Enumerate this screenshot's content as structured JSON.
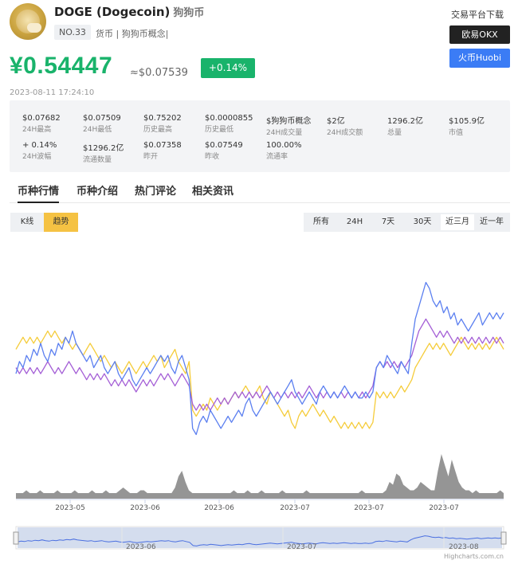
{
  "header": {
    "symbol_title": "DOGE (Dogecoin)",
    "cn_name": "狗狗币",
    "rank": "NO.33",
    "tags": "货币 | 狗狗币概念|"
  },
  "platforms": {
    "title": "交易平台下载",
    "okx": "欧易OKX",
    "huobi": "火币Huobi"
  },
  "price": {
    "cny": "¥0.54447",
    "usd": "≈$0.07539",
    "change": "+0.14%",
    "timestamp": "2023-08-11 17:24:10",
    "color_up": "#19b36b"
  },
  "stats": [
    {
      "value": "$0.07682",
      "label": "24H最高"
    },
    {
      "value": "$0.07509",
      "label": "24H最低"
    },
    {
      "value": "$0.75202",
      "label": "历史最高"
    },
    {
      "value": "$0.0000855",
      "label": "历史最低"
    },
    {
      "value": "$狗狗币概念",
      "label": "24H成交量"
    },
    {
      "value": "$2亿",
      "label": "24H成交额"
    },
    {
      "value": "1296.2亿",
      "label": "总量"
    },
    {
      "value": "$105.9亿",
      "label": "市值"
    },
    {
      "value": "+ 0.14%",
      "label": "24H波幅"
    },
    {
      "value": "$1296.2亿",
      "label": "流通数量"
    },
    {
      "value": "$0.07358",
      "label": "昨开"
    },
    {
      "value": "$0.07549",
      "label": "昨收"
    },
    {
      "value": "100.00%",
      "label": "流通率"
    }
  ],
  "tabs": [
    {
      "label": "币种行情",
      "active": true
    },
    {
      "label": "币种介绍",
      "active": false
    },
    {
      "label": "热门评论",
      "active": false
    },
    {
      "label": "相关资讯",
      "active": false
    }
  ],
  "chart_controls": {
    "kline": "K线",
    "trend": "趋势",
    "ranges": [
      "所有",
      "24H",
      "7天",
      "30天",
      "近三月",
      "近一年"
    ],
    "active_range": "近三月"
  },
  "chart_data": {
    "type": "line",
    "x_tick_labels": [
      "2023-05",
      "2023-06",
      "2023-06",
      "2023-07",
      "2023-07",
      "2023-07"
    ],
    "navigator_labels": [
      "2023-06",
      "2023-07",
      "2023-08"
    ],
    "credit": "Highcharts.com.cn",
    "colors": {
      "blue": "#5b7ff0",
      "yellow": "#f5cc3a",
      "purple": "#a45fd6",
      "volume": "#8a8a8a"
    },
    "series": [
      {
        "color": "blue",
        "values": [
          0.061,
          0.063,
          0.062,
          0.064,
          0.063,
          0.065,
          0.064,
          0.066,
          0.064,
          0.063,
          0.065,
          0.064,
          0.066,
          0.065,
          0.067,
          0.066,
          0.068,
          0.066,
          0.065,
          0.064,
          0.063,
          0.064,
          0.062,
          0.063,
          0.064,
          0.062,
          0.061,
          0.062,
          0.063,
          0.061,
          0.06,
          0.061,
          0.062,
          0.06,
          0.059,
          0.06,
          0.061,
          0.062,
          0.061,
          0.062,
          0.063,
          0.064,
          0.063,
          0.064,
          0.062,
          0.061,
          0.063,
          0.064,
          0.062,
          0.06,
          0.052,
          0.051,
          0.053,
          0.054,
          0.053,
          0.055,
          0.054,
          0.053,
          0.052,
          0.053,
          0.054,
          0.053,
          0.054,
          0.055,
          0.054,
          0.056,
          0.057,
          0.055,
          0.054,
          0.055,
          0.056,
          0.057,
          0.058,
          0.057,
          0.056,
          0.057,
          0.058,
          0.059,
          0.06,
          0.058,
          0.057,
          0.056,
          0.057,
          0.058,
          0.057,
          0.056,
          0.058,
          0.059,
          0.058,
          0.057,
          0.058,
          0.057,
          0.058,
          0.059,
          0.058,
          0.057,
          0.058,
          0.057,
          0.057,
          0.058,
          0.057,
          0.058,
          0.062,
          0.063,
          0.062,
          0.064,
          0.063,
          0.062,
          0.061,
          0.063,
          0.062,
          0.061,
          0.066,
          0.07,
          0.072,
          0.074,
          0.076,
          0.075,
          0.073,
          0.072,
          0.073,
          0.071,
          0.072,
          0.07,
          0.071,
          0.069,
          0.07,
          0.069,
          0.068,
          0.069,
          0.07,
          0.071,
          0.069,
          0.07,
          0.071,
          0.07,
          0.071,
          0.07,
          0.071
        ]
      },
      {
        "color": "yellow",
        "values": [
          0.065,
          0.066,
          0.067,
          0.066,
          0.067,
          0.066,
          0.067,
          0.066,
          0.067,
          0.068,
          0.067,
          0.068,
          0.067,
          0.066,
          0.067,
          0.066,
          0.065,
          0.066,
          0.065,
          0.064,
          0.065,
          0.066,
          0.065,
          0.064,
          0.063,
          0.064,
          0.063,
          0.062,
          0.063,
          0.062,
          0.061,
          0.062,
          0.063,
          0.062,
          0.061,
          0.062,
          0.063,
          0.062,
          0.063,
          0.064,
          0.063,
          0.064,
          0.062,
          0.063,
          0.064,
          0.065,
          0.063,
          0.062,
          0.061,
          0.063,
          0.055,
          0.054,
          0.055,
          0.056,
          0.055,
          0.057,
          0.056,
          0.055,
          0.056,
          0.057,
          0.056,
          0.057,
          0.058,
          0.057,
          0.058,
          0.059,
          0.058,
          0.057,
          0.058,
          0.059,
          0.057,
          0.056,
          0.058,
          0.057,
          0.056,
          0.055,
          0.054,
          0.055,
          0.053,
          0.052,
          0.054,
          0.055,
          0.054,
          0.055,
          0.056,
          0.055,
          0.054,
          0.055,
          0.054,
          0.053,
          0.054,
          0.053,
          0.052,
          0.053,
          0.052,
          0.053,
          0.052,
          0.053,
          0.052,
          0.053,
          0.052,
          0.053,
          0.058,
          0.057,
          0.058,
          0.057,
          0.058,
          0.057,
          0.058,
          0.059,
          0.058,
          0.059,
          0.06,
          0.062,
          0.063,
          0.064,
          0.065,
          0.066,
          0.065,
          0.066,
          0.065,
          0.066,
          0.065,
          0.064,
          0.065,
          0.066,
          0.067,
          0.066,
          0.065,
          0.066,
          0.065,
          0.066,
          0.065,
          0.066,
          0.065,
          0.066,
          0.067,
          0.066,
          0.065
        ]
      },
      {
        "color": "purple",
        "values": [
          0.062,
          0.061,
          0.062,
          0.061,
          0.062,
          0.061,
          0.062,
          0.061,
          0.062,
          0.063,
          0.062,
          0.061,
          0.062,
          0.061,
          0.062,
          0.063,
          0.062,
          0.061,
          0.062,
          0.061,
          0.06,
          0.061,
          0.06,
          0.061,
          0.06,
          0.061,
          0.06,
          0.059,
          0.06,
          0.059,
          0.06,
          0.059,
          0.06,
          0.059,
          0.058,
          0.059,
          0.06,
          0.059,
          0.06,
          0.059,
          0.06,
          0.061,
          0.06,
          0.061,
          0.06,
          0.059,
          0.06,
          0.061,
          0.06,
          0.059,
          0.056,
          0.055,
          0.056,
          0.055,
          0.056,
          0.055,
          0.056,
          0.057,
          0.056,
          0.057,
          0.056,
          0.057,
          0.058,
          0.057,
          0.058,
          0.057,
          0.058,
          0.057,
          0.058,
          0.057,
          0.058,
          0.059,
          0.058,
          0.057,
          0.058,
          0.057,
          0.058,
          0.057,
          0.058,
          0.057,
          0.058,
          0.057,
          0.058,
          0.059,
          0.058,
          0.057,
          0.058,
          0.057,
          0.058,
          0.057,
          0.058,
          0.057,
          0.058,
          0.057,
          0.058,
          0.057,
          0.058,
          0.057,
          0.058,
          0.057,
          0.058,
          0.059,
          0.062,
          0.063,
          0.062,
          0.063,
          0.062,
          0.063,
          0.062,
          0.063,
          0.062,
          0.063,
          0.064,
          0.066,
          0.068,
          0.069,
          0.07,
          0.069,
          0.068,
          0.067,
          0.068,
          0.067,
          0.068,
          0.067,
          0.066,
          0.067,
          0.066,
          0.067,
          0.066,
          0.067,
          0.066,
          0.067,
          0.066,
          0.067,
          0.066,
          0.067,
          0.066,
          0.067,
          0.066
        ]
      }
    ],
    "volume": [
      2,
      2,
      2,
      3,
      2,
      2,
      2,
      3,
      2,
      2,
      2,
      2,
      3,
      2,
      2,
      2,
      2,
      3,
      2,
      2,
      2,
      2,
      3,
      2,
      2,
      2,
      3,
      2,
      2,
      2,
      3,
      4,
      3,
      2,
      2,
      2,
      3,
      3,
      2,
      2,
      2,
      2,
      2,
      2,
      2,
      2,
      4,
      8,
      10,
      6,
      3,
      2,
      2,
      2,
      2,
      2,
      2,
      2,
      2,
      2,
      2,
      2,
      2,
      3,
      2,
      2,
      2,
      3,
      2,
      2,
      2,
      3,
      2,
      2,
      2,
      2,
      2,
      3,
      2,
      2,
      2,
      2,
      2,
      2,
      3,
      2,
      2,
      2,
      2,
      2,
      2,
      2,
      2,
      2,
      2,
      2,
      2,
      2,
      2,
      2,
      3,
      2,
      2,
      2,
      2,
      2,
      2,
      3,
      6,
      5,
      9,
      8,
      5,
      4,
      3,
      3,
      4,
      6,
      5,
      4,
      3,
      3,
      10,
      16,
      12,
      8,
      14,
      10,
      6,
      4,
      3,
      3,
      2,
      3,
      2,
      2,
      2,
      2,
      2,
      2,
      3,
      2
    ]
  }
}
